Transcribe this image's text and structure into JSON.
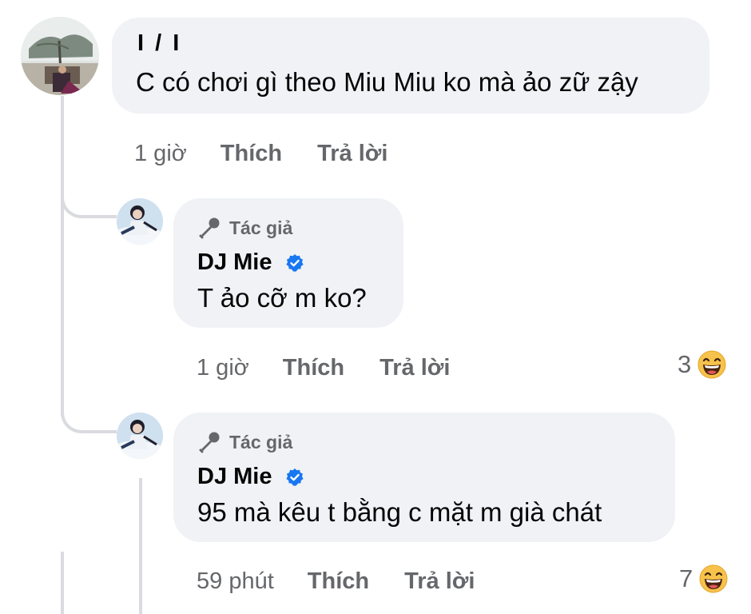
{
  "comments": [
    {
      "author": "I      /  I",
      "text": "C có chơi gì theo Miu Miu ko mà ảo zữ zậy",
      "time": "1 giờ",
      "like_label": "Thích",
      "reply_label": "Trả lời"
    }
  ],
  "replies": [
    {
      "author_tag": "Tác giả",
      "author": "DJ Mie",
      "text": "T ảo cỡ m ko?",
      "time": "1 giờ",
      "like_label": "Thích",
      "reply_label": "Trả lời",
      "reaction_count": "3",
      "reaction_icon": "haha-emoji-icon"
    },
    {
      "author_tag": "Tác giả",
      "author": "DJ Mie",
      "text": "95 mà kêu t bằng c mặt m già chát",
      "time": "59 phút",
      "like_label": "Thích",
      "reply_label": "Trả lời",
      "reaction_count": "7",
      "reaction_icon": "haha-emoji-icon"
    }
  ],
  "colors": {
    "bubble": "#f0f2f5",
    "text": "#050505",
    "secondary": "#65676b",
    "verified": "#1877f2",
    "thread_line": "#d9dbe0",
    "emoji_face": "#f7c24b"
  }
}
